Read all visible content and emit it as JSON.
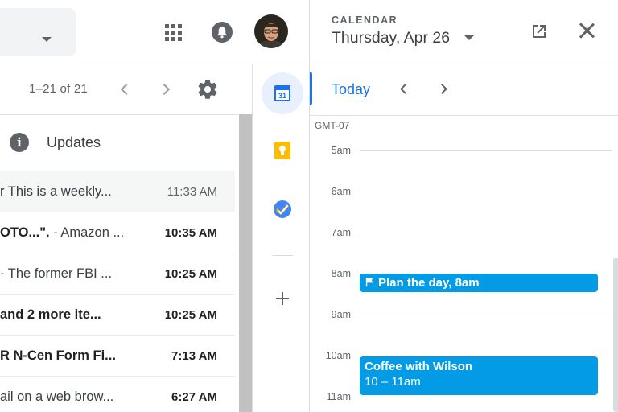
{
  "header": {
    "apps_icon": "apps-grid-icon",
    "notifications_icon": "bell-icon",
    "avatar": "user-avatar"
  },
  "mail_toolbar": {
    "pager": "1–21 of 21",
    "prev_icon": "chevron-left-icon",
    "next_icon": "chevron-right-icon",
    "settings_icon": "gear-icon"
  },
  "category": {
    "icon": "info-icon",
    "label": "Updates"
  },
  "mail_rows": [
    {
      "subject": "r This is a weekly...",
      "time": "11:33 AM",
      "unread": false
    },
    {
      "subject_bold": "OTO...\".",
      "subject": " - Amazon ...",
      "time": "10:35 AM",
      "unread": true
    },
    {
      "subject": "- The former FBI ...",
      "time": "10:25 AM",
      "unread": true
    },
    {
      "subject_bold": " and 2 more ite...",
      "subject": "",
      "time": "10:25 AM",
      "unread": true
    },
    {
      "subject_bold": "R N-Cen Form Fi...",
      "subject": "",
      "time": "7:13 AM",
      "unread": true
    },
    {
      "subject": "ail on a web brow...",
      "time": "6:27 AM",
      "unread": true
    }
  ],
  "side_panel": {
    "calendar_icon": "calendar-icon",
    "calendar_day": "31",
    "keep_icon": "keep-icon",
    "tasks_icon": "tasks-icon",
    "add_icon": "plus-icon"
  },
  "calendar": {
    "app_label": "CALENDAR",
    "date": "Thursday, Apr 26",
    "open_new_icon": "open-in-new-icon",
    "close_icon": "close-icon",
    "today_label": "Today",
    "timezone": "GMT-07",
    "hours": [
      "5am",
      "6am",
      "7am",
      "8am",
      "9am",
      "10am",
      "11am"
    ],
    "events": {
      "plan": {
        "title": "Plan the day, 8am",
        "icon": "flag-icon"
      },
      "coffee": {
        "title": "Coffee with Wilson",
        "time": "10 – 11am"
      }
    }
  },
  "colors": {
    "accent": "#1a73e8",
    "event": "#039be5",
    "keep": "#fbbc04",
    "tasks": "#4285f4"
  }
}
